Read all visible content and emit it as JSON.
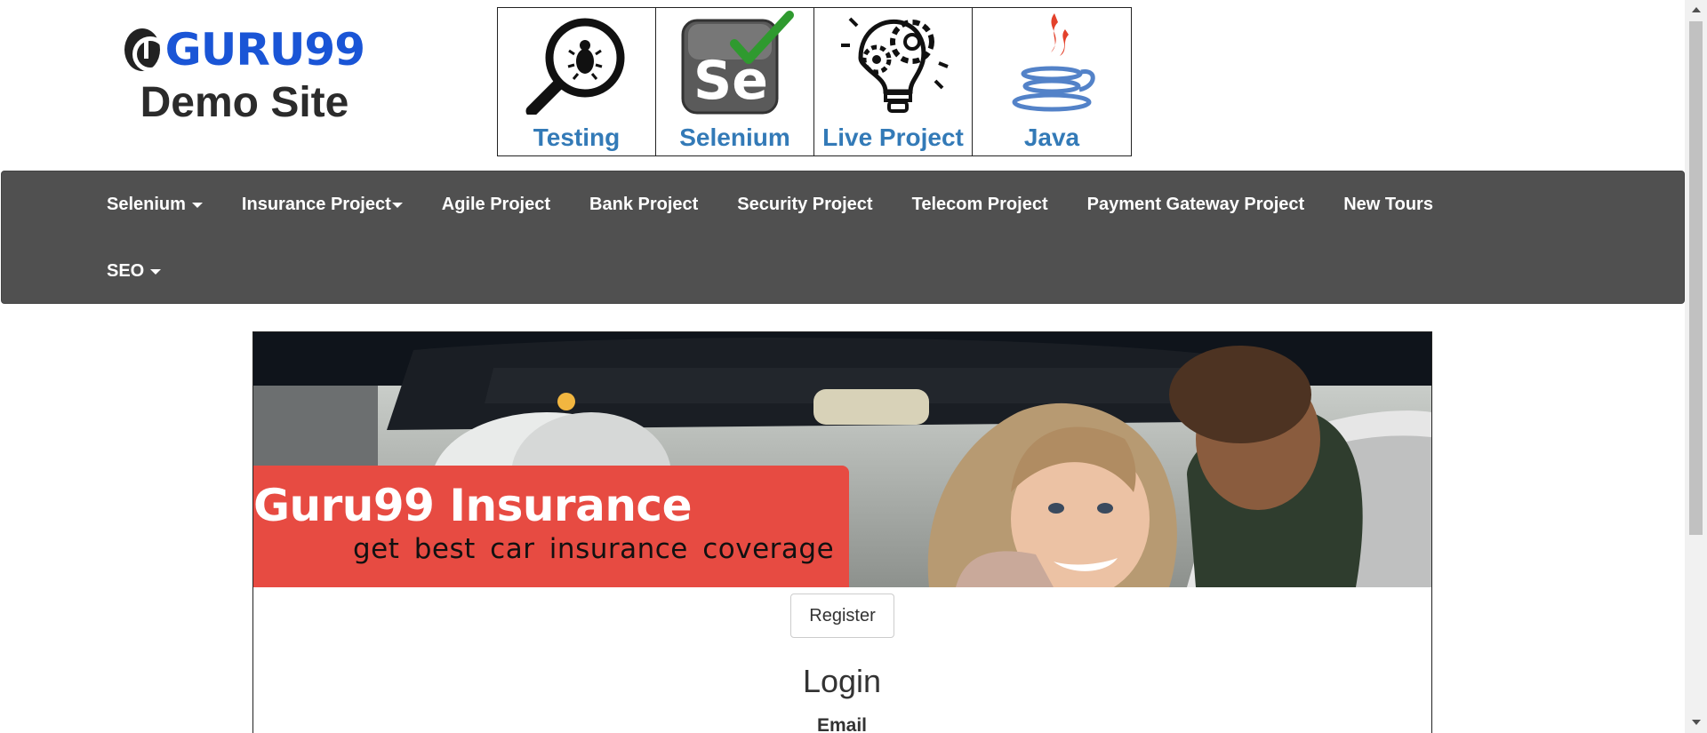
{
  "header": {
    "logo_text": "GURU99",
    "logo_subtitle": "Demo Site",
    "logo_icon": "guru99-logo-icon"
  },
  "topnav": [
    {
      "label": "Testing",
      "icon": "bug-magnifier-icon"
    },
    {
      "label": "Selenium",
      "icon": "selenium-check-icon"
    },
    {
      "label": "Live Project",
      "icon": "lightbulb-gears-icon"
    },
    {
      "label": "Java",
      "icon": "java-cup-icon"
    }
  ],
  "navbar": {
    "row1": [
      {
        "label": "Selenium",
        "dropdown": true
      },
      {
        "label": "Insurance Project",
        "dropdown": true
      },
      {
        "label": "Agile Project",
        "dropdown": false
      },
      {
        "label": "Bank Project",
        "dropdown": false
      },
      {
        "label": "Security Project",
        "dropdown": false
      },
      {
        "label": "Telecom Project",
        "dropdown": false
      },
      {
        "label": "Payment Gateway Project",
        "dropdown": false
      },
      {
        "label": "New Tours",
        "dropdown": false
      }
    ],
    "row2": [
      {
        "label": "SEO",
        "dropdown": true
      }
    ],
    "background": "#505050"
  },
  "banner": {
    "title": "Guru99 Insurance",
    "subtitle": "get best car insurance coverage",
    "accent_color": "#e74b42"
  },
  "form": {
    "register_label": "Register",
    "login_title": "Login",
    "email_label": "Email"
  },
  "colors": {
    "link_blue": "#337ab7",
    "logo_blue": "#1a55d6"
  }
}
